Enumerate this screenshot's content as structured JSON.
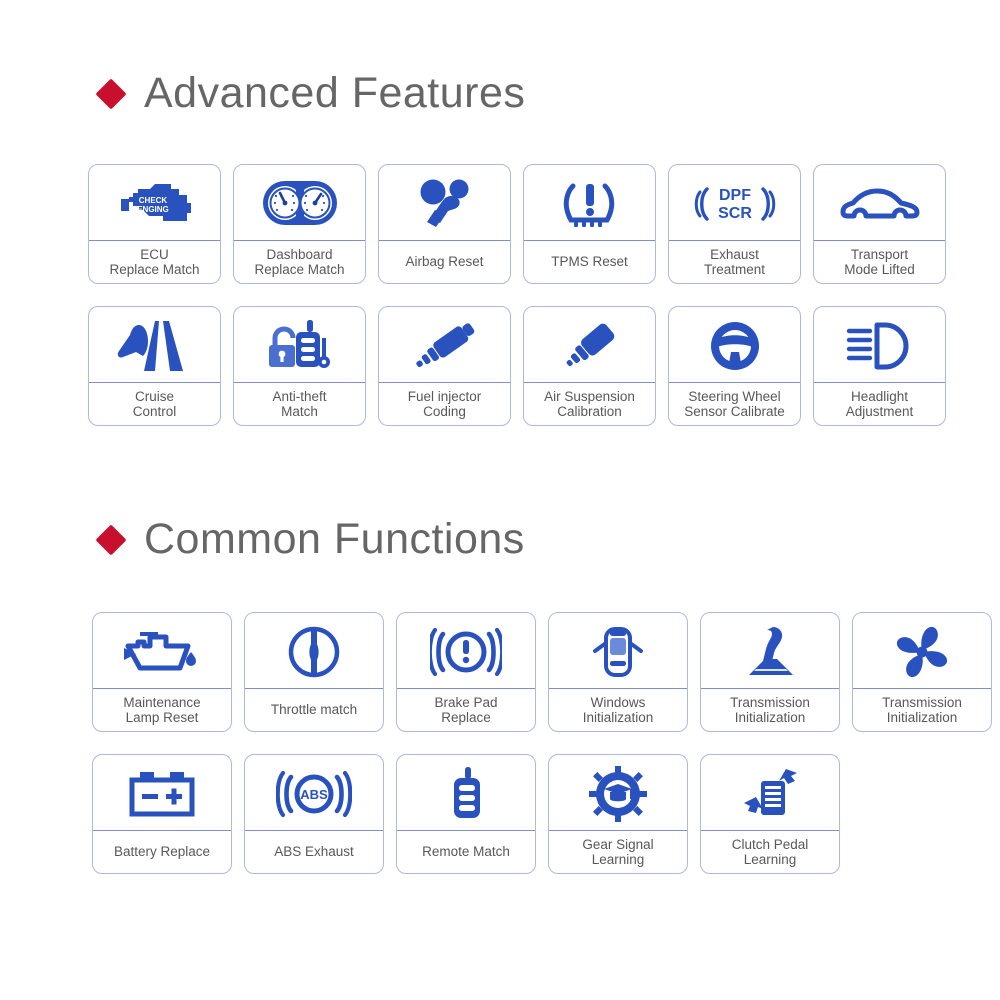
{
  "sections": [
    {
      "title": "Advanced Features",
      "bullet_color": "#c8102e",
      "rows": [
        [
          {
            "icon": "check-engine-icon",
            "label": "ECU\nReplace Match"
          },
          {
            "icon": "dashboard-gauges-icon",
            "label": "Dashboard\nReplace Match"
          },
          {
            "icon": "airbag-icon",
            "label": "Airbag Reset"
          },
          {
            "icon": "tire-pressure-icon",
            "label": "TPMS Reset"
          },
          {
            "icon": "dpf-scr-icon",
            "label": "Exhaust\nTreatment"
          },
          {
            "icon": "car-side-icon",
            "label": "Transport\nMode Lifted"
          }
        ],
        [
          {
            "icon": "road-cruise-icon",
            "label": "Cruise\nControl"
          },
          {
            "icon": "lock-key-remote-icon",
            "label": "Anti-theft\nMatch"
          },
          {
            "icon": "fuel-injector-icon",
            "label": "Fuel injector\nCoding"
          },
          {
            "icon": "air-suspension-icon",
            "label": "Air Suspension\nCalibration"
          },
          {
            "icon": "steering-wheel-icon",
            "label": "Steering Wheel\nSensor Calibrate"
          },
          {
            "icon": "headlight-icon",
            "label": "Headlight\nAdjustment"
          }
        ]
      ]
    },
    {
      "title": "Common Functions",
      "bullet_color": "#c8102e",
      "rows": [
        [
          {
            "icon": "oil-can-icon",
            "label": "Maintenance\nLamp Reset"
          },
          {
            "icon": "throttle-icon",
            "label": "Throttle match"
          },
          {
            "icon": "brake-pad-icon",
            "label": "Brake Pad\nReplace"
          },
          {
            "icon": "car-top-window-icon",
            "label": "Windows\nInitialization"
          },
          {
            "icon": "gear-shifter-icon",
            "label": "Transmission\nInitialization"
          },
          {
            "icon": "fan-icon",
            "label": "Transmission\nInitialization"
          }
        ],
        [
          {
            "icon": "battery-icon",
            "label": "Battery Replace"
          },
          {
            "icon": "abs-icon",
            "label": "ABS Exhaust"
          },
          {
            "icon": "remote-key-icon",
            "label": "Remote Match"
          },
          {
            "icon": "gear-graduation-icon",
            "label": "Gear Signal\nLearning"
          },
          {
            "icon": "clutch-pedal-icon",
            "label": "Clutch Pedal\nLearning"
          }
        ]
      ]
    }
  ],
  "colors": {
    "icon_blue": "#2a52be",
    "icon_blue_dark": "#1f3f9e",
    "card_border": "#aeb9e3",
    "divider": "#7e8fce",
    "title_gray": "#666666",
    "label_gray": "#585858",
    "accent_red": "#c8102e"
  }
}
